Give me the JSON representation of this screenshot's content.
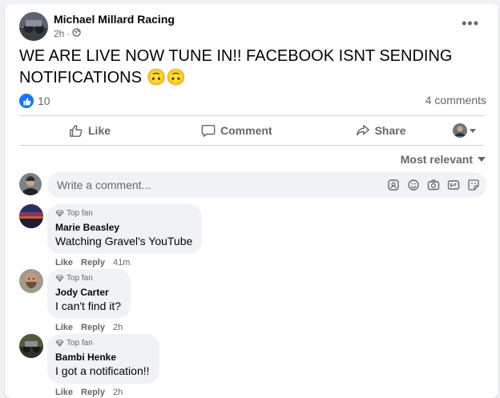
{
  "post": {
    "page_name": "Michael Millard Racing",
    "time": "2h",
    "text": "WE ARE LIVE NOW TUNE IN!! FACEBOOK ISNT SENDING NOTIFICATIONS 🙃🙃",
    "like_count": "10",
    "comments_count": "4 comments"
  },
  "actions": {
    "like": "Like",
    "comment": "Comment",
    "share": "Share"
  },
  "sort_label": "Most relevant",
  "comment_box": {
    "placeholder": "Write a comment..."
  },
  "comments": [
    {
      "badge": "Top fan",
      "author": "Marie Beasley",
      "text": "Watching Gravel's YouTube",
      "like": "Like",
      "reply": "Reply",
      "time": "41m"
    },
    {
      "badge": "Top fan",
      "author": "Jody Carter",
      "text": "I can't find it?",
      "like": "Like",
      "reply": "Reply",
      "time": "2h"
    },
    {
      "badge": "Top fan",
      "author": "Bambi Henke",
      "text": "I got a notification!!",
      "like": "Like",
      "reply": "Reply",
      "time": "2h"
    }
  ],
  "colors": {
    "accent": "#1877f2",
    "muted_text": "#65676b",
    "bubble_bg": "#f0f2f5"
  }
}
